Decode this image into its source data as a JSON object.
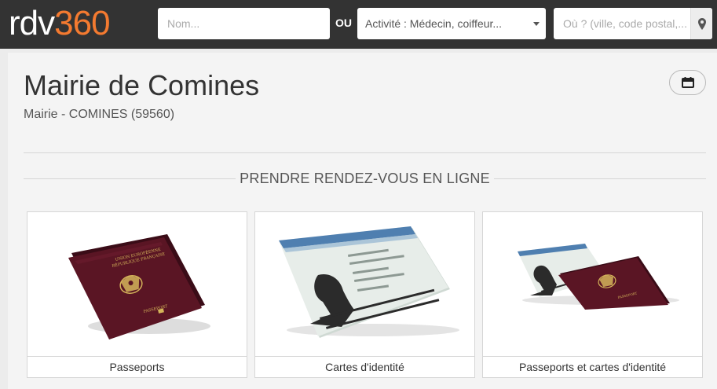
{
  "header": {
    "logo_part1": "rdv",
    "logo_part2": "360",
    "name_placeholder": "Nom...",
    "or_label": "OU",
    "activity_value": "Activité : Médecin, coiffeur...",
    "location_placeholder": "Où ? (ville, code postal,...",
    "icons": {
      "location": "map-pin-icon",
      "dropdown": "chevron-down-icon"
    }
  },
  "page": {
    "title": "Mairie de Comines",
    "subtitle": "Mairie - COMINES (59560)",
    "section_title": "PRENDRE RENDEZ-VOUS EN LIGNE",
    "calendar_icon": "calendar-icon"
  },
  "services": [
    {
      "label": "Passeports"
    },
    {
      "label": "Cartes d'identité"
    },
    {
      "label": "Passeports et cartes d'identité"
    }
  ],
  "colors": {
    "brand_orange": "#f47a30",
    "header_bg": "#333333",
    "passport_red": "#5a1524"
  }
}
